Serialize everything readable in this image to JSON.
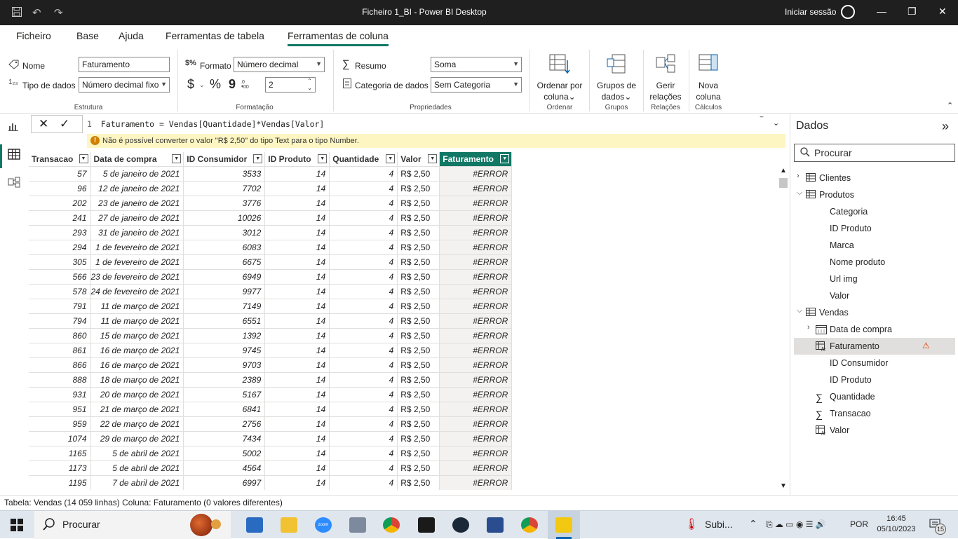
{
  "window": {
    "title": "Ficheiro 1_BI - Power BI Desktop",
    "signin": "Iniciar sessão"
  },
  "menu": {
    "tabs": [
      "Ficheiro",
      "Base",
      "Ajuda",
      "Ferramentas de tabela",
      "Ferramentas de coluna"
    ],
    "active": "Ferramentas de coluna"
  },
  "ribbon": {
    "name_label": "Nome",
    "name_value": "Faturamento",
    "datatype_label": "Tipo de dados",
    "datatype_value": "Número decimal fixo",
    "structure_group": "Estrutura",
    "format_label": "Formato",
    "format_value": "Número decimal",
    "currency_symbol": "$",
    "percent_symbol": "%",
    "comma_symbol": "9",
    "decimals_value": "2",
    "format_group": "Formatação",
    "summary_label": "Resumo",
    "summary_value": "Soma",
    "category_label": "Categoria de dados",
    "category_value": "Sem Categoria",
    "properties_group": "Propriedades",
    "sort_line1": "Ordenar por",
    "sort_line2": "coluna",
    "sort_group": "Ordenar",
    "groups_line1": "Grupos de",
    "groups_line2": "dados",
    "groups_group": "Grupos",
    "manage_line1": "Gerir",
    "manage_line2": "relações",
    "manage_group": "Relações",
    "newcol_line1": "Nova",
    "newcol_line2": "coluna",
    "calc_group": "Cálculos"
  },
  "formula": {
    "line_number": "1",
    "text": "Faturamento = Vendas[Quantidade]*Vendas[Valor]",
    "error": "Não é possível converter o valor \"R$ 2,50\" do tipo Text para o tipo Number."
  },
  "table": {
    "columns": [
      "Transacao",
      "Data de compra",
      "ID Consumidor",
      "ID Produto",
      "Quantidade",
      "Valor",
      "Faturamento"
    ],
    "rows": [
      [
        "57",
        "5 de janeiro de 2021",
        "3533",
        "14",
        "4",
        "R$ 2,50",
        "#ERROR"
      ],
      [
        "96",
        "12 de janeiro de 2021",
        "7702",
        "14",
        "4",
        "R$ 2,50",
        "#ERROR"
      ],
      [
        "202",
        "23 de janeiro de 2021",
        "3776",
        "14",
        "4",
        "R$ 2,50",
        "#ERROR"
      ],
      [
        "241",
        "27 de janeiro de 2021",
        "10026",
        "14",
        "4",
        "R$ 2,50",
        "#ERROR"
      ],
      [
        "293",
        "31 de janeiro de 2021",
        "3012",
        "14",
        "4",
        "R$ 2,50",
        "#ERROR"
      ],
      [
        "294",
        "1 de fevereiro de 2021",
        "6083",
        "14",
        "4",
        "R$ 2,50",
        "#ERROR"
      ],
      [
        "305",
        "1 de fevereiro de 2021",
        "6675",
        "14",
        "4",
        "R$ 2,50",
        "#ERROR"
      ],
      [
        "566",
        "23 de fevereiro de 2021",
        "6949",
        "14",
        "4",
        "R$ 2,50",
        "#ERROR"
      ],
      [
        "578",
        "24 de fevereiro de 2021",
        "9977",
        "14",
        "4",
        "R$ 2,50",
        "#ERROR"
      ],
      [
        "791",
        "11 de março de 2021",
        "7149",
        "14",
        "4",
        "R$ 2,50",
        "#ERROR"
      ],
      [
        "794",
        "11 de março de 2021",
        "6551",
        "14",
        "4",
        "R$ 2,50",
        "#ERROR"
      ],
      [
        "860",
        "15 de março de 2021",
        "1392",
        "14",
        "4",
        "R$ 2,50",
        "#ERROR"
      ],
      [
        "861",
        "16 de março de 2021",
        "9745",
        "14",
        "4",
        "R$ 2,50",
        "#ERROR"
      ],
      [
        "866",
        "16 de março de 2021",
        "9703",
        "14",
        "4",
        "R$ 2,50",
        "#ERROR"
      ],
      [
        "888",
        "18 de março de 2021",
        "2389",
        "14",
        "4",
        "R$ 2,50",
        "#ERROR"
      ],
      [
        "931",
        "20 de março de 2021",
        "5167",
        "14",
        "4",
        "R$ 2,50",
        "#ERROR"
      ],
      [
        "951",
        "21 de março de 2021",
        "6841",
        "14",
        "4",
        "R$ 2,50",
        "#ERROR"
      ],
      [
        "959",
        "22 de março de 2021",
        "2756",
        "14",
        "4",
        "R$ 2,50",
        "#ERROR"
      ],
      [
        "1074",
        "29 de março de 2021",
        "7434",
        "14",
        "4",
        "R$ 2,50",
        "#ERROR"
      ],
      [
        "1165",
        "5 de abril de 2021",
        "5002",
        "14",
        "4",
        "R$ 2,50",
        "#ERROR"
      ],
      [
        "1173",
        "5 de abril de 2021",
        "4564",
        "14",
        "4",
        "R$ 2,50",
        "#ERROR"
      ],
      [
        "1195",
        "7 de abril de 2021",
        "6997",
        "14",
        "4",
        "R$ 2,50",
        "#ERROR"
      ]
    ]
  },
  "data_pane": {
    "title": "Dados",
    "search_placeholder": "Procurar",
    "items": [
      {
        "label": "Clientes",
        "kind": "table",
        "expanded": false
      },
      {
        "label": "Produtos",
        "kind": "table",
        "expanded": true
      },
      {
        "label": "Categoria",
        "kind": "field"
      },
      {
        "label": "ID Produto",
        "kind": "field"
      },
      {
        "label": "Marca",
        "kind": "field"
      },
      {
        "label": "Nome produto",
        "kind": "field"
      },
      {
        "label": "Url img",
        "kind": "field"
      },
      {
        "label": "Valor",
        "kind": "field"
      },
      {
        "label": "Vendas",
        "kind": "table",
        "expanded": true
      },
      {
        "label": "Data de compra",
        "kind": "date"
      },
      {
        "label": "Faturamento",
        "kind": "calc",
        "selected": true,
        "warning": true
      },
      {
        "label": "ID Consumidor",
        "kind": "field"
      },
      {
        "label": "ID Produto",
        "kind": "field"
      },
      {
        "label": "Quantidade",
        "kind": "sum"
      },
      {
        "label": "Transacao",
        "kind": "sum"
      },
      {
        "label": "Valor",
        "kind": "calc"
      }
    ]
  },
  "status": {
    "text": "Tabela: Vendas (14 059 linhas) Coluna: Faturamento (0 valores diferentes)"
  },
  "taskbar": {
    "search": "Procurar",
    "weather": "Subi...",
    "language": "POR",
    "time": "16:45",
    "date": "05/10/2023",
    "notifications": "15"
  },
  "colors": {
    "accent": "#117865",
    "error_bar": "#fdf6c3",
    "warning": "#d83b01"
  }
}
